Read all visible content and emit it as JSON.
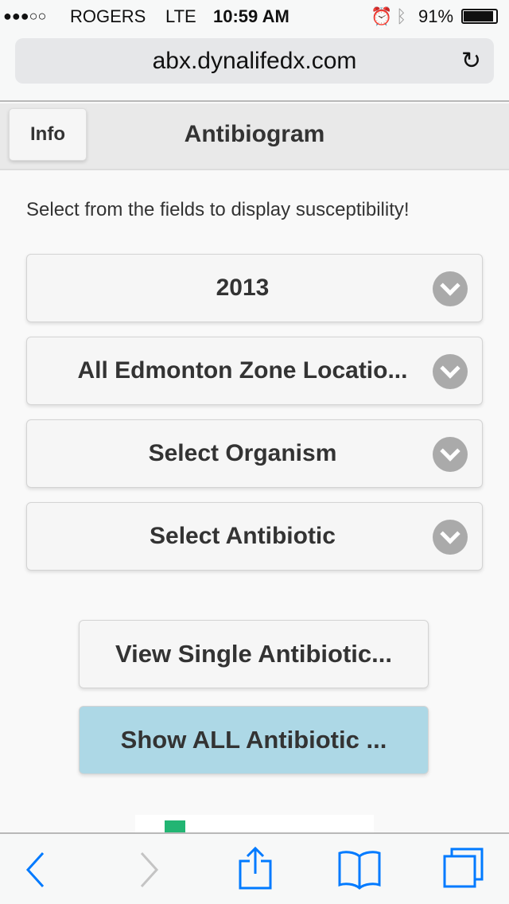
{
  "status": {
    "signal": "●●●○○",
    "carrier": "ROGERS",
    "network": "LTE",
    "time": "10:59 AM",
    "battery": "91%"
  },
  "browser": {
    "url": "abx.dynalifedx.com"
  },
  "header": {
    "info_label": "Info",
    "title": "Antibiogram"
  },
  "main": {
    "intro": "Select from the fields to display susceptibility!",
    "selects": [
      {
        "value": "2013"
      },
      {
        "value": "All Edmonton Zone Locatio..."
      },
      {
        "value": "Select Organism"
      },
      {
        "value": "Select Antibiotic"
      }
    ],
    "view_single_label": "View Single Antibiotic...",
    "show_all_label": "Show ALL Antibiotic ..."
  },
  "colors": {
    "accent": "#007aff",
    "show_all_bg": "#add8e6",
    "chart_green": "#22b573"
  }
}
